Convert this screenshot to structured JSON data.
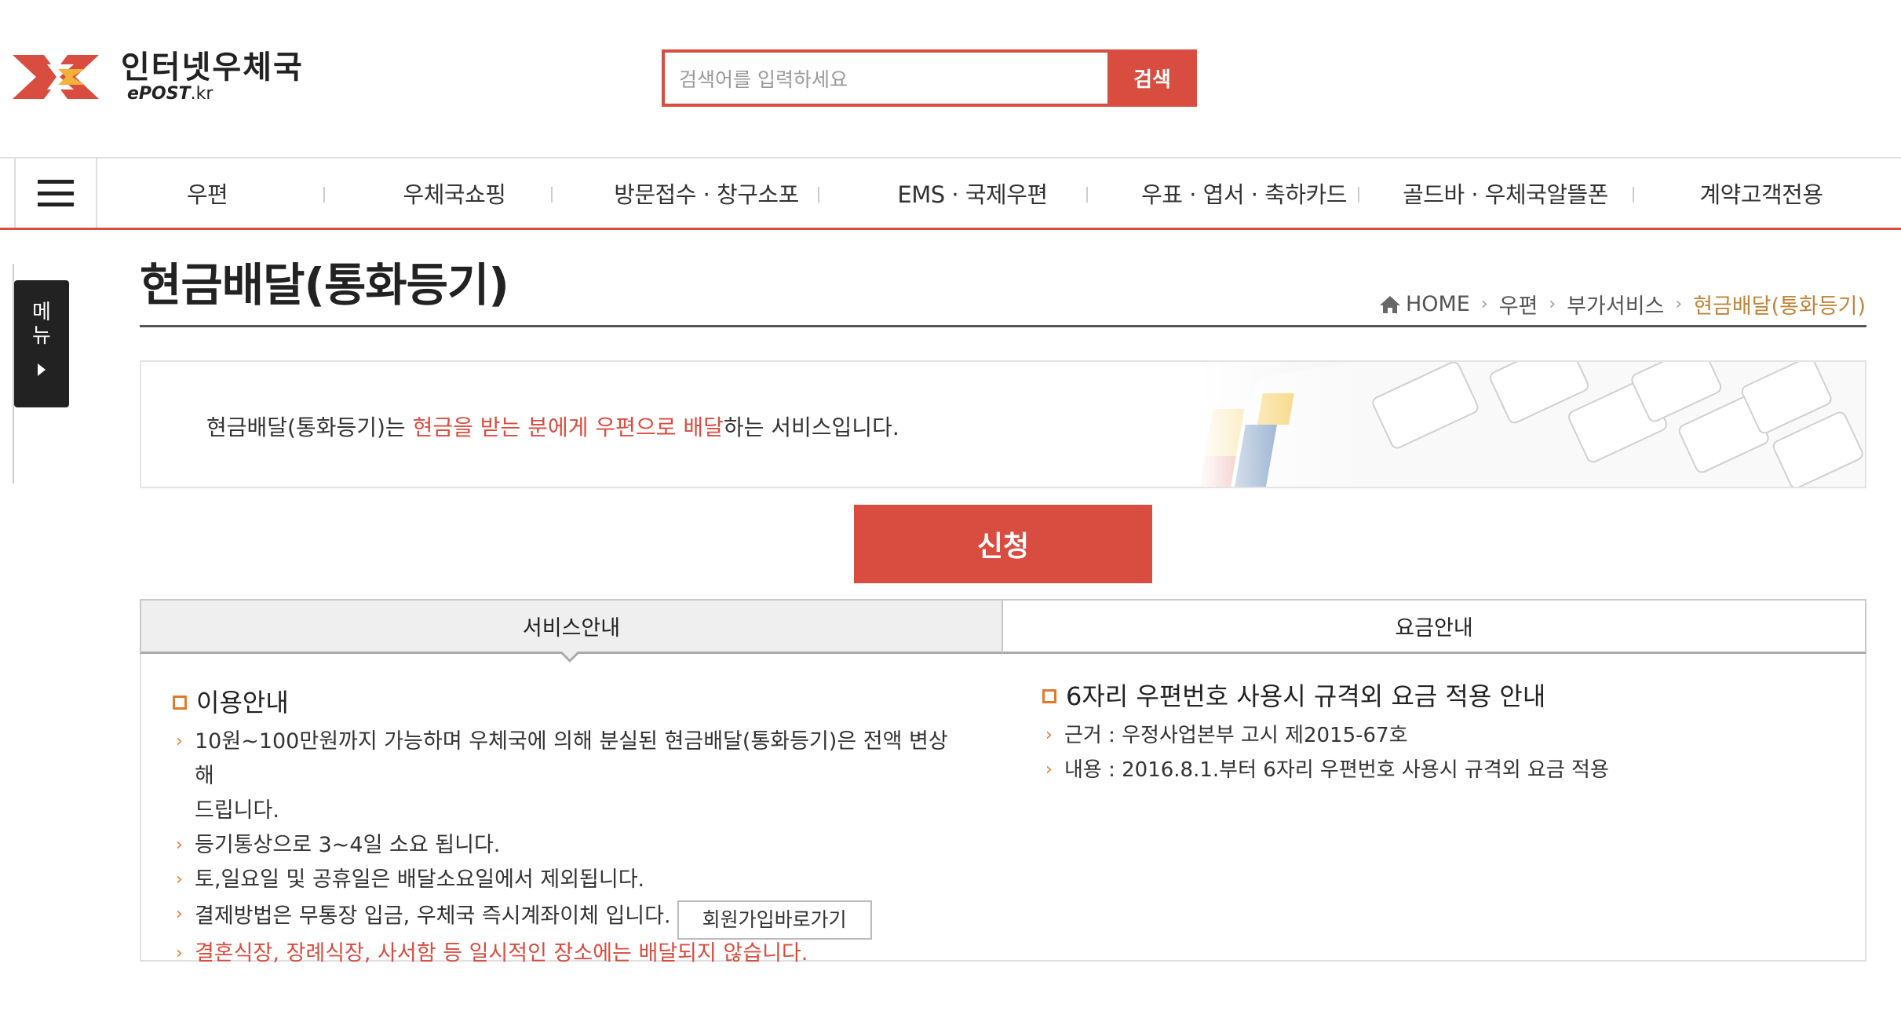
{
  "header": {
    "logo_title": "인터넷우체국",
    "logo_sub_prefix": "ePOST",
    "logo_sub_suffix": ".kr",
    "search_placeholder": "검색어를 입력하세요",
    "search_button": "검색"
  },
  "nav": {
    "menu_icon": "hamburger-icon",
    "items": [
      {
        "label": "우편"
      },
      {
        "label": "우체국쇼핑"
      },
      {
        "label": "방문접수 · 창구소포"
      },
      {
        "label": "EMS · 국제우편"
      },
      {
        "label": "우표 · 엽서 · 축하카드"
      },
      {
        "label": "골드바 · 우체국알뜰폰"
      },
      {
        "label": "계약고객전용"
      }
    ]
  },
  "side_tab": {
    "label_1": "메",
    "label_2": "뉴"
  },
  "page": {
    "title": "현금배달(통화등기)",
    "breadcrumb": [
      "HOME",
      "우편",
      "부가서비스",
      "현금배달(통화등기)"
    ]
  },
  "banner": {
    "text_before": "현금배달(통화등기)는 ",
    "text_highlight": "현금을 받는 분에게 우편으로 배달",
    "text_after": "하는 서비스입니다."
  },
  "apply_button": "신청",
  "tabs": {
    "service": "서비스안내",
    "fee": "요금안내"
  },
  "usage": {
    "heading": "이용안내",
    "items": [
      "10원~100만원까지 가능하며 우체국에 의해 분실된 현금배달(통화등기)은 전액 변상해",
      "드립니다.",
      "등기통상으로 3~4일 소요 됩니다.",
      "토,일요일 및 공휴일은 배달소요일에서 제외됩니다.",
      "결제방법은 무통장 입금, 우체국 즉시계좌이체 입니다.",
      "결혼식장, 장례식장, 사서함 등 일시적인 장소에는 배달되지 않습니다."
    ],
    "join_button": "회원가입바로가기"
  },
  "notice": {
    "heading": "6자리 우편번호 사용시 규격외 요금 적용 안내",
    "items": [
      "근거 : 우정사업본부 고시 제2015-67호",
      "내용 : 2016.8.1.부터 6자리 우편번호 사용시 규격외 요금 적용"
    ]
  },
  "colors": {
    "accent": "#d94c40",
    "bullet": "#e07a2e",
    "breadcrumb_current": "#c0843a"
  }
}
